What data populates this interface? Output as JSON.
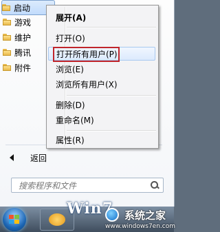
{
  "programs": [
    {
      "label": "启动",
      "selected": true
    },
    {
      "label": "游戏",
      "selected": false
    },
    {
      "label": "维护",
      "selected": false
    },
    {
      "label": "腾讯",
      "selected": false
    },
    {
      "label": "附件",
      "selected": false
    }
  ],
  "back_label": "返回",
  "search": {
    "placeholder": "搜索程序和文件"
  },
  "context_menu": {
    "expand": "展开(A)",
    "open": "打开(O)",
    "open_all_users": "打开所有用户(P)",
    "explore": "浏览(E)",
    "explore_all_users": "浏览所有用户(X)",
    "delete": "删除(D)",
    "rename": "重命名(M)",
    "properties": "属性(R)"
  },
  "watermark": {
    "logo": "Win7",
    "name": "系统之家",
    "url": "www.windows7en.com"
  },
  "colors": {
    "highlight_border": "#c0242a",
    "hover_fill": "#dceafd"
  }
}
